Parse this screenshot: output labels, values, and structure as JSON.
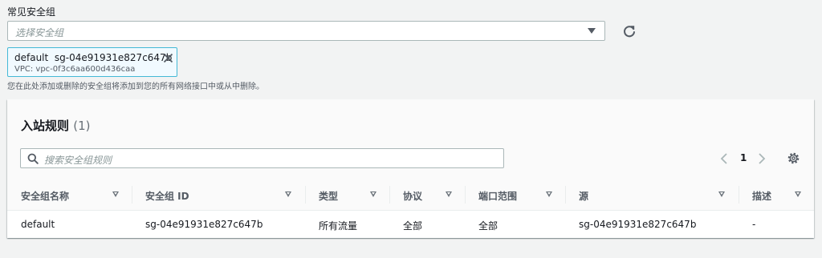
{
  "form": {
    "label": "常见安全组",
    "select_placeholder": "选择安全组",
    "token": {
      "name": "default",
      "id": "sg-04e91931e827c647b",
      "vpc": "VPC: vpc-0f3c6aa600d436caa"
    },
    "hint": "您在此处添加或删除的安全组将添加到您的所有网络接口中或从中删除。"
  },
  "inbound": {
    "title": "入站规则",
    "count": "(1)",
    "search_placeholder": "搜索安全组规则",
    "page": "1",
    "columns": [
      "安全组名称",
      "安全组 ID",
      "类型",
      "协议",
      "端口范围",
      "源",
      "描述"
    ],
    "rows": [
      [
        "default",
        "sg-04e91931e827c647b",
        "所有流量",
        "全部",
        "全部",
        "sg-04e91931e827c647b",
        "-"
      ]
    ]
  },
  "icons": {
    "refresh": "refresh-icon",
    "close": "close-icon",
    "search": "search-icon",
    "prev": "chevron-left-icon",
    "next": "chevron-right-icon",
    "settings": "gear-icon",
    "sort": "sort-down-icon"
  }
}
